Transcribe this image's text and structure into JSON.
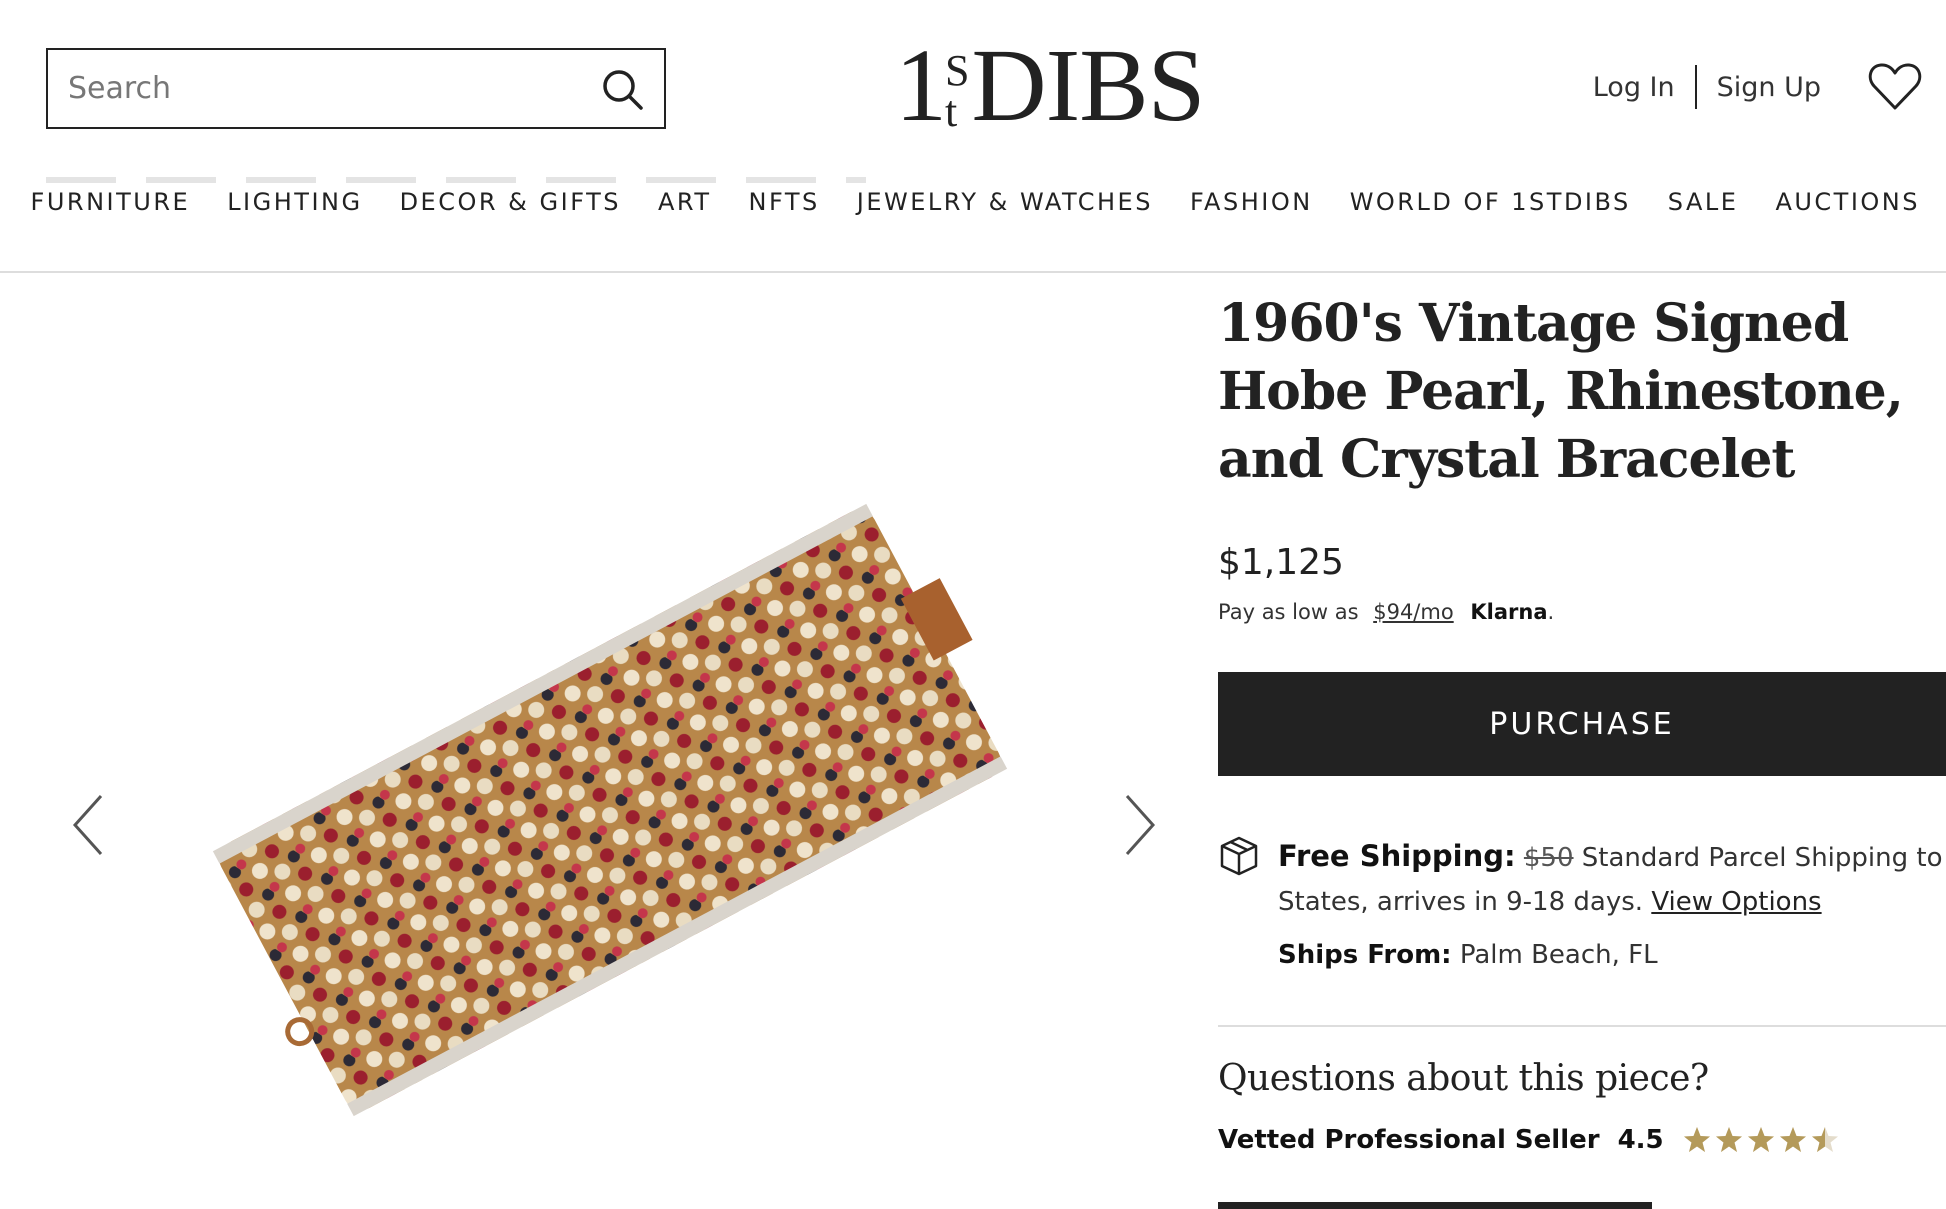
{
  "header": {
    "search_placeholder": "Search",
    "logo": {
      "one": "1",
      "s": "S",
      "t": "t",
      "dibs": "DIBS"
    },
    "login_label": "Log In",
    "signup_label": "Sign Up"
  },
  "nav": {
    "items": [
      "FURNITURE",
      "LIGHTING",
      "DECOR & GIFTS",
      "ART",
      "NFTS",
      "JEWELRY & WATCHES",
      "FASHION",
      "WORLD OF 1STDIBS",
      "SALE",
      "AUCTIONS"
    ]
  },
  "product": {
    "title": "1960's Vintage Signed Hobe Pearl, Rhinestone, and Crystal Bracelet",
    "price": "$1,125",
    "klarna_prefix": "Pay as low as",
    "klarna_monthly": "$94/mo",
    "klarna_brand": "Klarna",
    "klarna_suffix": ".",
    "purchase_label": "PURCHASE"
  },
  "shipping": {
    "label": "Free Shipping:",
    "original_price": "$50",
    "description_part1": "Standard Parcel Shipping to Un",
    "description_part2": "States, arrives in 9-18 days.",
    "view_options_label": "View Options",
    "ships_from_label": "Ships From:",
    "ships_from_value": "Palm Beach, FL"
  },
  "seller": {
    "questions_heading": "Questions about this piece?",
    "vetted_label": "Vetted Professional Seller",
    "rating": "4.5",
    "stars_filled": 4.5,
    "stars_total": 5,
    "star_color": "#b49a5a"
  },
  "colors": {
    "text": "#222222",
    "button_bg": "#222222",
    "button_text": "#ffffff",
    "rule": "#dddddd"
  }
}
